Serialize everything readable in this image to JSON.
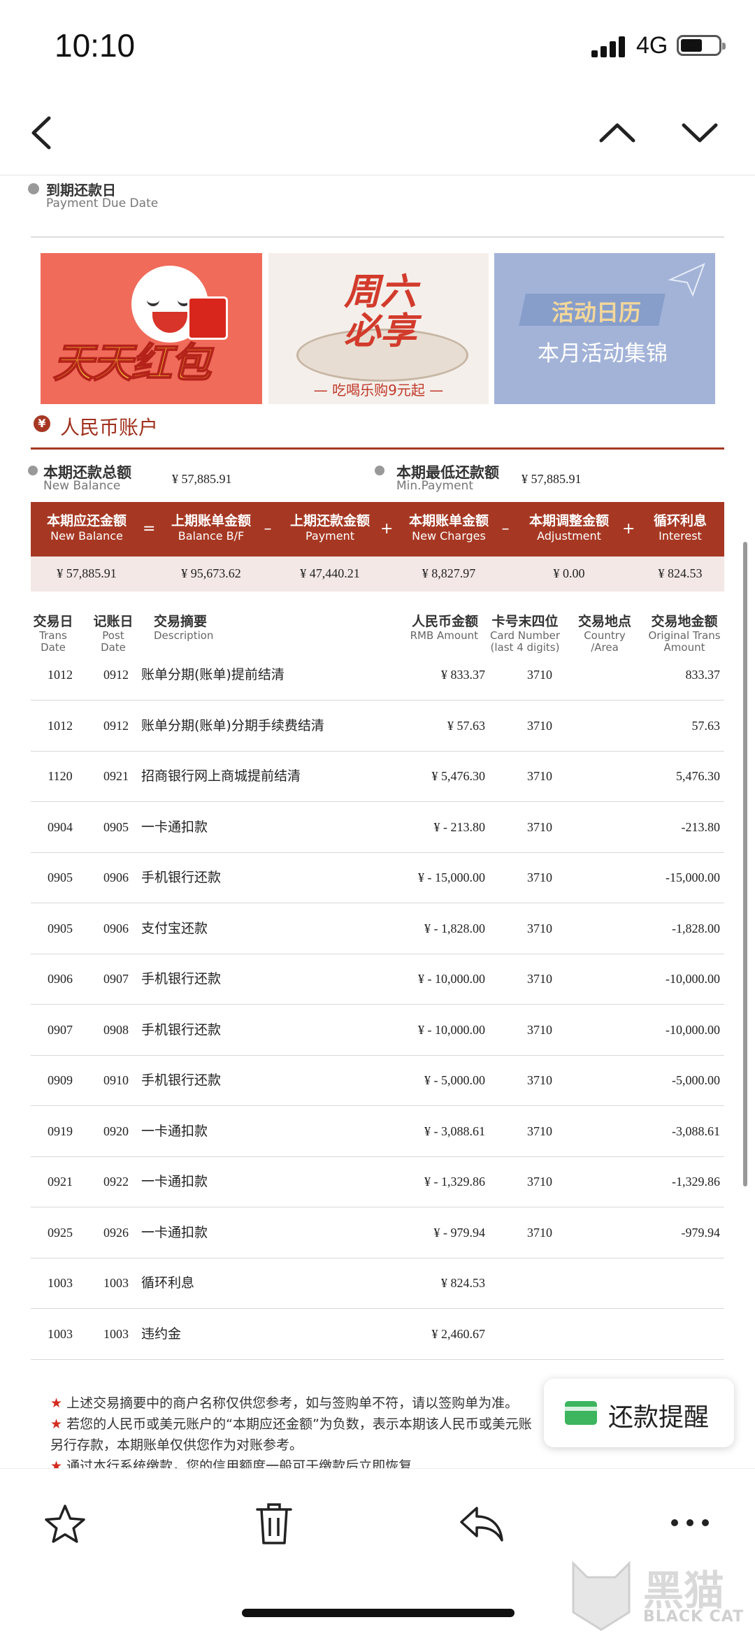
{
  "status_bar": {
    "time": "10:10",
    "network": "4G"
  },
  "header": {
    "back_icon": "chevron-left-icon",
    "prev_icon": "chevron-up-icon",
    "next_icon": "chevron-down-icon"
  },
  "due_date": {
    "cn": "到期还款日",
    "en": "Payment Due Date"
  },
  "banners": [
    {
      "text": "天天红包"
    },
    {
      "text": "周六必享",
      "sub": "— 吃喝乐购9元起 —"
    },
    {
      "text": "活动日历",
      "sub": "本月活动集锦"
    }
  ],
  "account": {
    "icon": "yen-icon",
    "title": "人民币账户"
  },
  "summary": {
    "new_balance": {
      "cn": "本期还款总额",
      "en": "New Balance",
      "value": "¥ 57,885.91"
    },
    "min_payment": {
      "cn": "本期最低还款额",
      "en": "Min.Payment",
      "value": "¥ 57,885.91"
    }
  },
  "formula": {
    "headers": [
      {
        "cn": "本期应还金额",
        "en": "New Balance"
      },
      {
        "cn": "上期账单金额",
        "en": "Balance B/F"
      },
      {
        "cn": "上期还款金额",
        "en": "Payment"
      },
      {
        "cn": "本期账单金额",
        "en": "New Charges"
      },
      {
        "cn": "本期调整金额",
        "en": "Adjustment"
      },
      {
        "cn": "循环利息",
        "en": "Interest"
      }
    ],
    "operators": [
      "=",
      "–",
      "+",
      "–",
      "+"
    ],
    "values": [
      "¥ 57,885.91",
      "¥ 95,673.62",
      "¥ 47,440.21",
      "¥ 8,827.97",
      "¥ 0.00",
      "¥ 824.53"
    ]
  },
  "table": {
    "columns": [
      {
        "cn": "交易日",
        "en": "Trans\nDate"
      },
      {
        "cn": "记账日",
        "en": "Post\nDate"
      },
      {
        "cn": "交易摘要",
        "en": "Description"
      },
      {
        "cn": "人民币金额",
        "en": "RMB Amount"
      },
      {
        "cn": "卡号末四位",
        "en": "Card Number\n(last 4 digits)"
      },
      {
        "cn": "交易地点",
        "en": "Country\n/Area"
      },
      {
        "cn": "交易地金额",
        "en": "Original Trans\nAmount"
      }
    ],
    "rows": [
      {
        "trans": "1012",
        "post": "0912",
        "desc": "账单分期(账单)提前结清",
        "rmb": "¥ 833.37",
        "card": "3710",
        "orig": "833.37"
      },
      {
        "trans": "1012",
        "post": "0912",
        "desc": "账单分期(账单)分期手续费结清",
        "rmb": "¥ 57.63",
        "card": "3710",
        "orig": "57.63"
      },
      {
        "trans": "1120",
        "post": "0921",
        "desc": "招商银行网上商城提前结清",
        "rmb": "¥ 5,476.30",
        "card": "3710",
        "orig": "5,476.30"
      },
      {
        "trans": "0904",
        "post": "0905",
        "desc": "一卡通扣款",
        "rmb": "¥ - 213.80",
        "card": "3710",
        "orig": "-213.80"
      },
      {
        "trans": "0905",
        "post": "0906",
        "desc": "手机银行还款",
        "rmb": "¥ - 15,000.00",
        "card": "3710",
        "orig": "-15,000.00"
      },
      {
        "trans": "0905",
        "post": "0906",
        "desc": "支付宝还款",
        "rmb": "¥ - 1,828.00",
        "card": "3710",
        "orig": "-1,828.00"
      },
      {
        "trans": "0906",
        "post": "0907",
        "desc": "手机银行还款",
        "rmb": "¥ - 10,000.00",
        "card": "3710",
        "orig": "-10,000.00"
      },
      {
        "trans": "0907",
        "post": "0908",
        "desc": "手机银行还款",
        "rmb": "¥ - 10,000.00",
        "card": "3710",
        "orig": "-10,000.00"
      },
      {
        "trans": "0909",
        "post": "0910",
        "desc": "手机银行还款",
        "rmb": "¥ - 5,000.00",
        "card": "3710",
        "orig": "-5,000.00"
      },
      {
        "trans": "0919",
        "post": "0920",
        "desc": "一卡通扣款",
        "rmb": "¥ - 3,088.61",
        "card": "3710",
        "orig": "-3,088.61"
      },
      {
        "trans": "0921",
        "post": "0922",
        "desc": "一卡通扣款",
        "rmb": "¥ - 1,329.86",
        "card": "3710",
        "orig": "-1,329.86"
      },
      {
        "trans": "0925",
        "post": "0926",
        "desc": "一卡通扣款",
        "rmb": "¥ - 979.94",
        "card": "3710",
        "orig": "-979.94"
      },
      {
        "trans": "1003",
        "post": "1003",
        "desc": "循环利息",
        "rmb": "¥ 824.53",
        "card": "",
        "orig": ""
      },
      {
        "trans": "1003",
        "post": "1003",
        "desc": "违约金",
        "rmb": "¥ 2,460.67",
        "card": "",
        "orig": ""
      }
    ]
  },
  "notes": [
    "上述交易摘要中的商户名称仅供您参考，如与签购单不符，请以签购单为准。",
    "若您的人民币或美元账户的“本期应还金额”为负数，表示本期该人民币或美元账",
    "另行存款，本期账单仅供您作为对账参考。",
    "通过本行系统缴款，您的信用额度一般可于缴款后立即恢复"
  ],
  "reminder_button": {
    "label": "还款提醒",
    "icon": "card-icon"
  },
  "toolbar": {
    "icons": [
      "star-icon",
      "trash-icon",
      "reply-icon",
      "more-icon"
    ]
  },
  "watermark": {
    "cn": "黑猫",
    "en": "BLACK CAT"
  },
  "colors": {
    "accent": "#a63823",
    "accent_text": "#a0301e",
    "formula_row": "#f3e8e6"
  }
}
